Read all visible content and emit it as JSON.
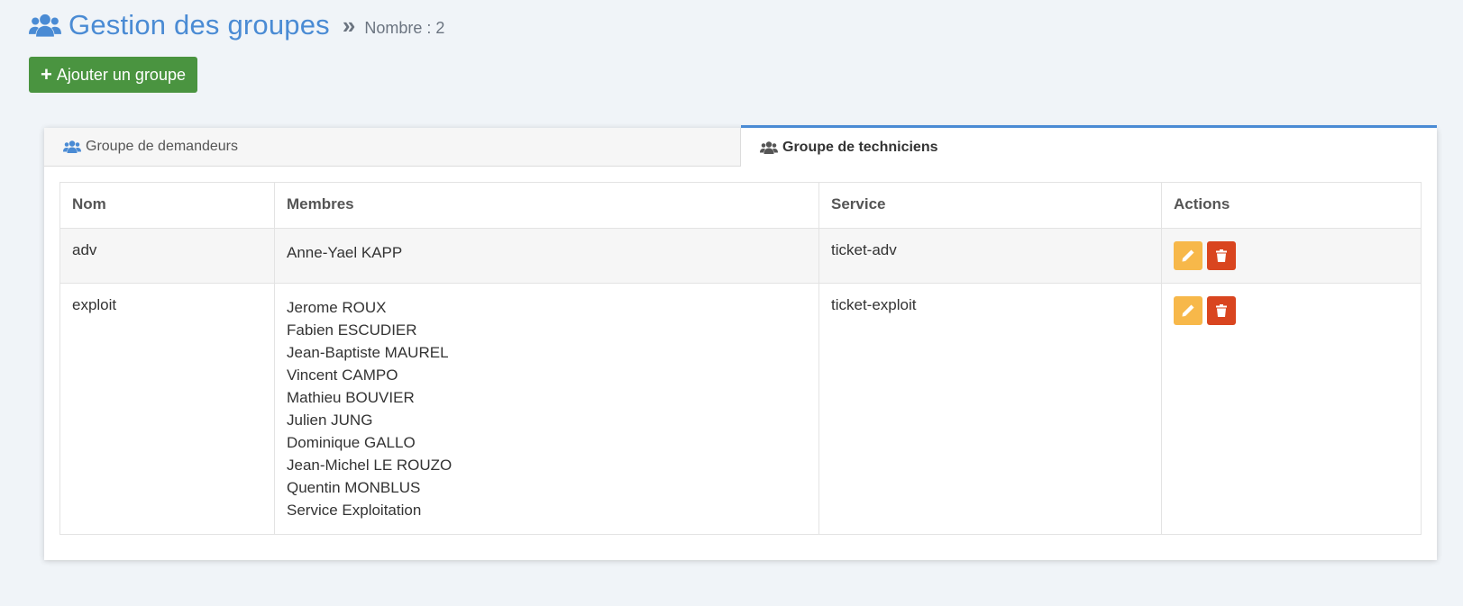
{
  "header": {
    "title": "Gestion des groupes",
    "count_label": "Nombre : 2",
    "title_icon": "users-icon",
    "separator_icon": "double-chevron-right-icon"
  },
  "toolbar": {
    "add_label": "Ajouter un groupe",
    "add_icon": "plus-icon"
  },
  "tabs": [
    {
      "label": "Groupe de demandeurs",
      "icon": "users-icon",
      "active": false
    },
    {
      "label": "Groupe de techniciens",
      "icon": "users-icon",
      "active": true
    }
  ],
  "table": {
    "headers": {
      "name": "Nom",
      "members": "Membres",
      "service": "Service",
      "actions": "Actions"
    },
    "rows": [
      {
        "name": "adv",
        "members": [
          "Anne-Yael KAPP"
        ],
        "service": "ticket-adv"
      },
      {
        "name": "exploit",
        "members": [
          "Jerome ROUX",
          "Fabien ESCUDIER",
          "Jean-Baptiste MAUREL",
          "Vincent CAMPO",
          "Mathieu BOUVIER",
          "Julien JUNG",
          "Dominique GALLO",
          "Jean-Michel LE ROUZO",
          "Quentin MONBLUS",
          "Service Exploitation"
        ],
        "service": "ticket-exploit"
      }
    ],
    "action_icons": [
      "pencil-icon",
      "trash-icon"
    ]
  },
  "colors": {
    "accent": "#4a8bd4",
    "add_button": "#4a9440",
    "edit_button": "#f7b84a",
    "delete_button": "#d9451f",
    "background": "#f0f4f8"
  }
}
